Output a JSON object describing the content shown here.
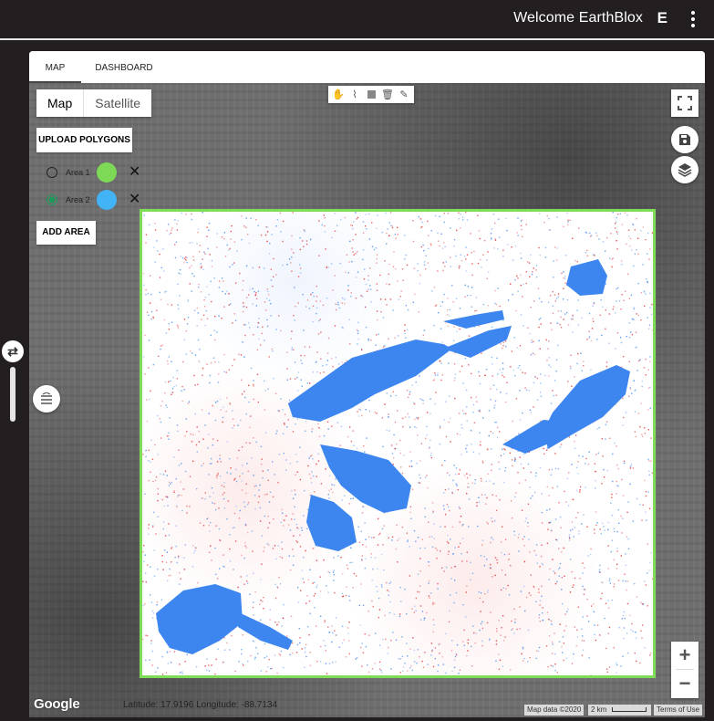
{
  "header": {
    "welcome_text": "Welcome EarthBlox",
    "avatar_letter": "E"
  },
  "tabs": [
    {
      "label": "MAP",
      "active": true
    },
    {
      "label": "DASHBOARD",
      "active": false
    }
  ],
  "map_type": {
    "options": [
      "Map",
      "Satellite"
    ],
    "selected": "Map"
  },
  "draw_tools": [
    "hand-icon",
    "polyline-icon",
    "rectangle-icon",
    "trash-icon",
    "brush-icon"
  ],
  "panel": {
    "upload_label": "UPLOAD POLYGONS",
    "add_area_label": "ADD AREA",
    "areas": [
      {
        "label": "Area 1",
        "color": "#7ed957",
        "selected": false
      },
      {
        "label": "Area 2",
        "color": "#42b4f5",
        "selected": true
      }
    ]
  },
  "overlay": {
    "border_color": "#7fdc57",
    "water_color": "#3d86f0",
    "noise_red": "#e0282b",
    "noise_blue": "#3d86f0"
  },
  "footer": {
    "google_logo": "Google",
    "coordinates": "Latitude: 17.9196 Longitude: -88.7134",
    "map_data": "Map data ©2020",
    "scale": "2 km",
    "terms": "Terms of Use"
  },
  "zoom": {
    "in": "+",
    "out": "−"
  }
}
